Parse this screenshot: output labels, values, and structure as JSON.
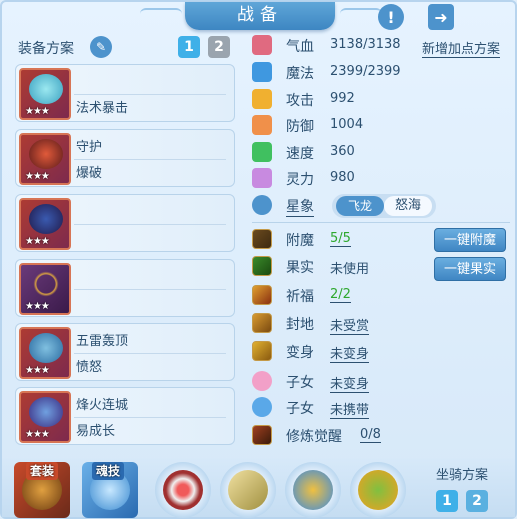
{
  "header": {
    "title": "战备",
    "help_icon": "exclamation-icon",
    "share_icon": "share-icon"
  },
  "plan": {
    "label": "装备方案",
    "btn1": "1",
    "btn2": "2"
  },
  "slots": [
    {
      "line1": "",
      "line2": "法术暴击",
      "stars": "★★★"
    },
    {
      "line1": "守护",
      "line2": "爆破",
      "stars": "★★★"
    },
    {
      "line1": "",
      "line2": "",
      "stars": "★★★"
    },
    {
      "line1": "",
      "line2": "",
      "stars": "★★★"
    },
    {
      "line1": "五雷轰顶",
      "line2": "愤怒",
      "stars": "★★★"
    },
    {
      "line1": "烽火连城",
      "line2": "易成长",
      "stars": "★★★"
    }
  ],
  "stats": [
    {
      "name": "气血",
      "value": "3138/3138",
      "color": "#e06a80"
    },
    {
      "name": "魔法",
      "value": "2399/2399",
      "color": "#3f98e0"
    },
    {
      "name": "攻击",
      "value": "992",
      "color": "#f0b030"
    },
    {
      "name": "防御",
      "value": "1004",
      "color": "#f0904a"
    },
    {
      "name": "速度",
      "value": "360",
      "color": "#40c060"
    },
    {
      "name": "灵力",
      "value": "980",
      "color": "#c88ae0"
    }
  ],
  "add_point_plan": "新增加点方案",
  "star": {
    "label": "星象",
    "option_a": "飞龙",
    "option_b": "怒海"
  },
  "actions": [
    {
      "name": "附魔",
      "value": "5/5",
      "style": "green"
    },
    {
      "name": "果实",
      "value": "未使用",
      "style": "plain"
    },
    {
      "name": "祈福",
      "value": "2/2",
      "style": "green"
    },
    {
      "name": "封地",
      "value": "未受赏",
      "style": "under"
    },
    {
      "name": "变身",
      "value": "未变身",
      "style": "under"
    },
    {
      "name": "子女",
      "value": "未变身",
      "style": "under"
    },
    {
      "name": "子女",
      "value": "未携带",
      "style": "under"
    },
    {
      "name": "修炼觉醒",
      "value": "0/8",
      "style": "under"
    }
  ],
  "buttons": {
    "enchant": "一键附魔",
    "fruit": "一键果实"
  },
  "bottom": {
    "set_label": "套装",
    "soul_label": "魂技",
    "mount_label": "坐骑方案",
    "mount1": "1",
    "mount2": "2"
  }
}
